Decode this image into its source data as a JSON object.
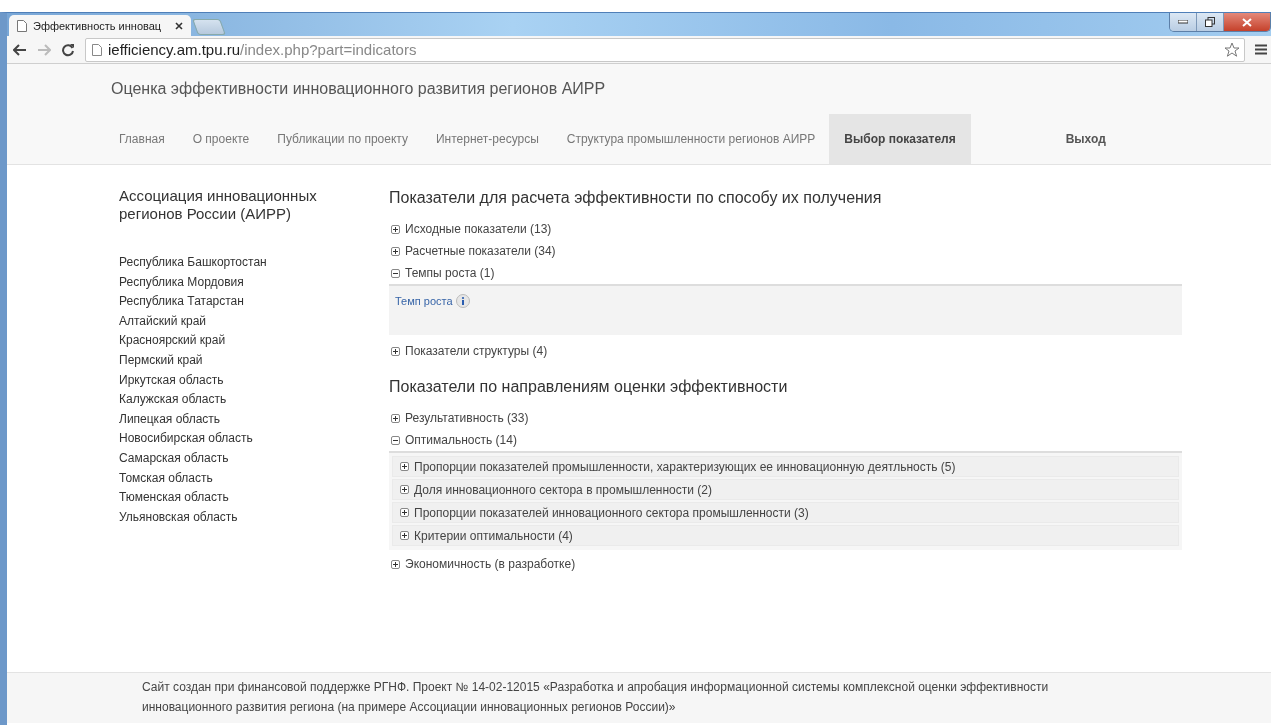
{
  "browser": {
    "tab_title": "Эффективность инновац",
    "url_host": "iefficiency.am.tpu.ru",
    "url_path": "/index.php?part=indicators"
  },
  "site_title": "Оценка эффективности инновационного развития регионов АИРР",
  "nav": [
    {
      "label": "Главная",
      "selected": false
    },
    {
      "label": "О проекте",
      "selected": false
    },
    {
      "label": "Публикации по проекту",
      "selected": false
    },
    {
      "label": "Интернет-ресурсы",
      "selected": false
    },
    {
      "label": "Структура промышленности регионов АИРР",
      "selected": false
    },
    {
      "label": "Выбор показателя",
      "selected": true
    }
  ],
  "logout": "Выход",
  "sidebar": {
    "heading": "Ассоциация инновационных регионов России (АИРР)",
    "regions": [
      "Республика Башкортостан",
      "Республика Мордовия",
      "Республика Татарстан",
      "Алтайский край",
      "Красноярский край",
      "Пермский край",
      "Иркутская область",
      "Калужская область",
      "Липецкая область",
      "Новосибирская область",
      "Самарская область",
      "Томская область",
      "Тюменская область",
      "Ульяновская область"
    ]
  },
  "sections": [
    {
      "title": "Показатели для расчета эффективности по способу их получения",
      "groups": [
        {
          "label": "Исходные показатели (13)",
          "expanded": false
        },
        {
          "label": "Расчетные показатели (34)",
          "expanded": false
        },
        {
          "label": "Темпы роста (1)",
          "expanded": true,
          "children": [
            {
              "kind": "link",
              "label": "Темп роста"
            }
          ]
        },
        {
          "label": "Показатели структуры (4)",
          "expanded": false
        }
      ]
    },
    {
      "title": "Показатели по направлениям оценки эффективности",
      "groups": [
        {
          "label": "Результативность (33)",
          "expanded": false
        },
        {
          "label": "Оптимальность (14)",
          "expanded": true,
          "children": [
            {
              "kind": "group",
              "label": "Пропорции показателей промышленности, характеризующих ее инновационную деятльность (5)",
              "expanded": false
            },
            {
              "kind": "group",
              "label": "Доля инновационного сектора в промышленности (2)",
              "expanded": false
            },
            {
              "kind": "group",
              "label": "Пропорции показателей инновационного сектора промышленности (3)",
              "expanded": false
            },
            {
              "kind": "group",
              "label": "Критерии оптимальности (4)",
              "expanded": false
            }
          ]
        },
        {
          "label": "Экономичность (в разработке)",
          "expanded": false
        }
      ]
    }
  ],
  "footer": "Сайт создан при финансовой поддержке РГНФ. Проект № 14-02-12015 «Разработка и апробация информационной системы комплексной оценки эффективности инновационного развития региона (на примере Ассоциации инновационных регионов России)»"
}
